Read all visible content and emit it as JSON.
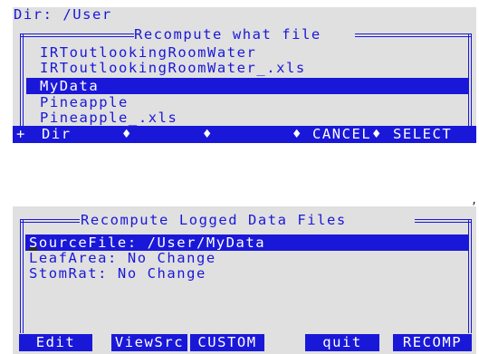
{
  "top_dialog": {
    "dir_label": "Dir: /User",
    "title": "Recompute what file",
    "files": [
      {
        "name": "IRToutlookingRoomWater",
        "selected": false
      },
      {
        "name": "IRToutlookingRoomWater_.xls",
        "selected": false
      },
      {
        "name": "MyData",
        "selected": true
      },
      {
        "name": "Pineapple",
        "selected": false
      },
      {
        "name": "Pineapple_.xls",
        "selected": false
      }
    ],
    "bar": {
      "plus": "+",
      "dir": "Dir",
      "diamond1": "♦",
      "diamond2": "♦",
      "diamond3": "♦",
      "cancel": "CANCEL",
      "diamond4": "♦",
      "select": "SELECT"
    }
  },
  "corner_mark": ",",
  "bottom_dialog": {
    "title": "Recompute Logged Data Files",
    "rows": [
      {
        "text": "SourceFile: /User/MyData",
        "selected": true
      },
      {
        "text": "LeafArea: No Change",
        "selected": false
      },
      {
        "text": "StomRat: No Change",
        "selected": false
      }
    ],
    "softkeys": {
      "edit": "Edit",
      "viewsrc": "ViewSrc",
      "custom": "CUSTOM",
      "quit": "quit",
      "recomp": "RECOMP"
    }
  },
  "colors": {
    "text": "#1a18d8",
    "panel": "#e0e0e0",
    "highlight_text": "#ffffff"
  }
}
